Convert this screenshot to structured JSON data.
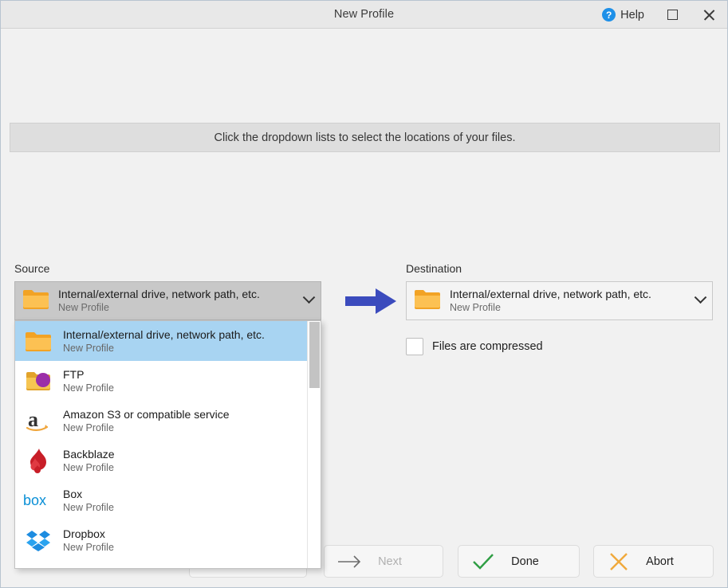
{
  "window": {
    "title": "New Profile",
    "help_label": "Help",
    "maximize_label": "Maximize",
    "close_label": "Close",
    "help_glyph": "?"
  },
  "banner": {
    "text": "Click the dropdown lists to select the locations of your files."
  },
  "source": {
    "label": "Source",
    "selected": {
      "title": "Internal/external drive, network path, etc.",
      "subtitle": "New Profile",
      "icon": "folder-icon"
    },
    "dropdown_open": true,
    "options": [
      {
        "title": "Internal/external drive, network path, etc.",
        "subtitle": "New Profile",
        "icon": "folder-icon",
        "selected": true
      },
      {
        "title": "FTP",
        "subtitle": "New Profile",
        "icon": "ftp-folder-icon",
        "selected": false
      },
      {
        "title": "Amazon S3 or compatible service",
        "subtitle": "New Profile",
        "icon": "amazon-icon",
        "selected": false
      },
      {
        "title": "Backblaze",
        "subtitle": "New Profile",
        "icon": "backblaze-icon",
        "selected": false
      },
      {
        "title": "Box",
        "subtitle": "New Profile",
        "icon": "box-icon",
        "selected": false
      },
      {
        "title": "Dropbox",
        "subtitle": "New Profile",
        "icon": "dropbox-icon",
        "selected": false
      }
    ]
  },
  "destination": {
    "label": "Destination",
    "selected": {
      "title": "Internal/external drive, network path, etc.",
      "subtitle": "New Profile",
      "icon": "folder-icon"
    },
    "compressed_checkbox": {
      "label": "Files are compressed",
      "checked": false
    }
  },
  "flow_arrow": {
    "icon": "right-arrow-icon",
    "color": "#3b4bbd"
  },
  "footer": {
    "buttons": [
      {
        "id": "back",
        "label": "",
        "icon": "arrow-left-icon",
        "enabled": true
      },
      {
        "id": "next",
        "label": "Next",
        "icon": "arrow-right-icon",
        "enabled": false
      },
      {
        "id": "done",
        "label": "Done",
        "icon": "check-icon",
        "enabled": true
      },
      {
        "id": "abort",
        "label": "Abort",
        "icon": "cross-icon",
        "enabled": true
      }
    ]
  },
  "colors": {
    "accent_blue": "#1e90e8",
    "selection_blue": "#a8d4f2",
    "arrow_indigo": "#3b4bbd",
    "folder_orange": "#f5a623",
    "done_green": "#2f9e44",
    "abort_orange": "#f0a93c",
    "titlebar_bg": "#e8e8e8",
    "banner_bg": "#dedede",
    "window_bg": "#f1f1f1"
  }
}
